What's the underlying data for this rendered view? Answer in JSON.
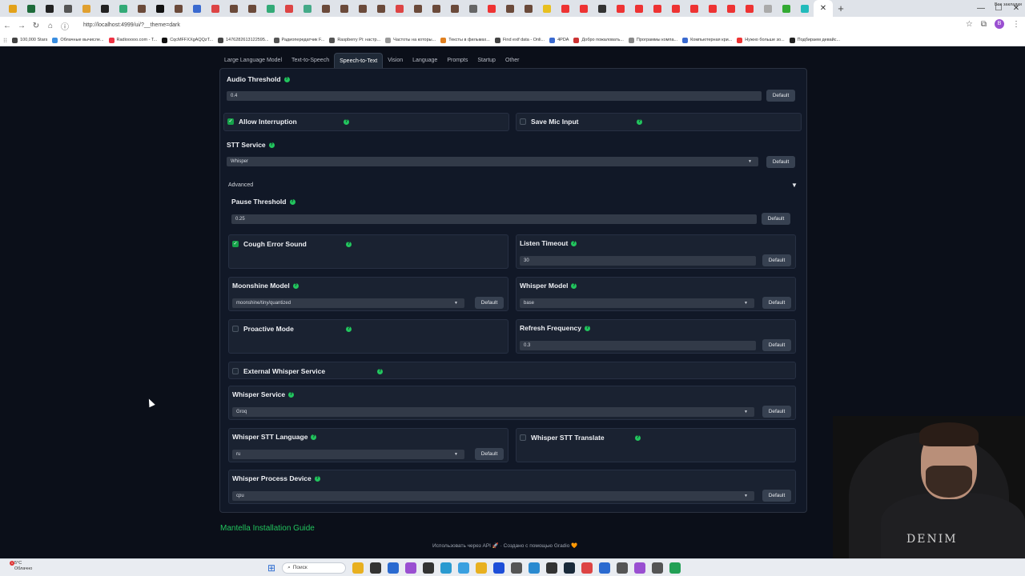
{
  "browser": {
    "url": "http://localhost:4999/ui/?__theme=dark",
    "tab_colors": [
      "#e3a21a",
      "#1e6b3a",
      "#222",
      "#555",
      "#e0a030",
      "#222",
      "#3a7",
      "#6b4a3a",
      "#111",
      "#6b4a3a",
      "#3a6ad0",
      "#d44",
      "#6b4a3a",
      "#6b4a3a",
      "#3a7",
      "#d44",
      "#4a8",
      "#6b4a3a",
      "#6b4a3a",
      "#6b4a3a",
      "#6b4a3a",
      "#d44",
      "#6b4a3a",
      "#6b4a3a",
      "#6b4a3a",
      "#666",
      "#e33",
      "#6b4a3a",
      "#6b4a3a",
      "#e8c020",
      "#e33",
      "#e33",
      "#333",
      "#e33",
      "#e33",
      "#e33",
      "#e33",
      "#e33",
      "#e33",
      "#e33",
      "#e33",
      "#aaa",
      "#3a3",
      "#2bb"
    ],
    "bookmarks": [
      {
        "label": "100,000 Stars",
        "color": "#444"
      },
      {
        "label": "Облачные вычисле...",
        "color": "#3a8ee0"
      },
      {
        "label": "Radiooooo.com - T...",
        "color": "#e34"
      },
      {
        "label": "CqcMFFXXgAQQzT...",
        "color": "#111"
      },
      {
        "label": "1476282613122595...",
        "color": "#444"
      },
      {
        "label": "Радиопередатчик F...",
        "color": "#555"
      },
      {
        "label": "Raspberry Pi: настр...",
        "color": "#555"
      },
      {
        "label": "Частоты на которы...",
        "color": "#999"
      },
      {
        "label": "Тексты в фильмах...",
        "color": "#e08020"
      },
      {
        "label": "Find exif data - Onli...",
        "color": "#444"
      },
      {
        "label": "4PDA",
        "color": "#3a6ad0"
      },
      {
        "label": "Добро пожаловать...",
        "color": "#c33"
      },
      {
        "label": "Программы компа...",
        "color": "#888"
      },
      {
        "label": "Компьютерная кри...",
        "color": "#3a6ad0"
      },
      {
        "label": "Нужно больше зо...",
        "color": "#e33"
      },
      {
        "label": "Подбираем девайс...",
        "color": "#222"
      }
    ],
    "bookmarks_right": "Все закладки"
  },
  "tabs": [
    "Large Language Model",
    "Text-to-Speech",
    "Speech-to-Text",
    "Vision",
    "Language",
    "Prompts",
    "Startup",
    "Other"
  ],
  "selected_tab": "Speech-to-Text",
  "default_label": "Default",
  "fields": {
    "audio_threshold": {
      "label": "Audio Threshold",
      "value": "0.4"
    },
    "allow_interruption": {
      "label": "Allow Interruption",
      "checked": true
    },
    "save_mic_input": {
      "label": "Save Mic Input",
      "checked": false
    },
    "stt_service": {
      "label": "STT Service",
      "value": "Whisper"
    },
    "advanced": {
      "label": "Advanced"
    },
    "pause_threshold": {
      "label": "Pause Threshold",
      "value": "0.25"
    },
    "cough_error_sound": {
      "label": "Cough Error Sound",
      "checked": true
    },
    "listen_timeout": {
      "label": "Listen Timeout",
      "value": "30"
    },
    "moonshine_model": {
      "label": "Moonshine Model",
      "value": "moonshine/tiny/quantized"
    },
    "whisper_model": {
      "label": "Whisper Model",
      "value": "base"
    },
    "proactive_mode": {
      "label": "Proactive Mode",
      "checked": false
    },
    "refresh_frequency": {
      "label": "Refresh Frequency",
      "value": "0.3"
    },
    "external_whisper_service": {
      "label": "External Whisper Service",
      "checked": false
    },
    "whisper_service": {
      "label": "Whisper Service",
      "value": "Groq"
    },
    "whisper_stt_language": {
      "label": "Whisper STT Language",
      "value": "ru"
    },
    "whisper_stt_translate": {
      "label": "Whisper STT Translate",
      "checked": false
    },
    "whisper_process_device": {
      "label": "Whisper Process Device",
      "value": "cpu"
    }
  },
  "guide_link": "Mantella Installation Guide",
  "footer": "Использовать через API 🚀 · Создано с помощью Gradio 🧡",
  "taskbar": {
    "temp": "5°C",
    "weather": "Облачно",
    "notif": "1",
    "search_placeholder": "Поиск",
    "icon_colors": [
      "#e8b020",
      "#333",
      "#2a6ad0",
      "#9a4fd1",
      "#333",
      "#2a9ad0",
      "#3aa0e0",
      "#e8b020",
      "#1d4ed8",
      "#555",
      "#2a8ad0",
      "#333",
      "#1a2a3a",
      "#d44",
      "#2a6ad0",
      "#555",
      "#9a4fd1",
      "#555",
      "#22a055"
    ]
  },
  "webcam": {
    "shirt_text": "DENIM"
  }
}
